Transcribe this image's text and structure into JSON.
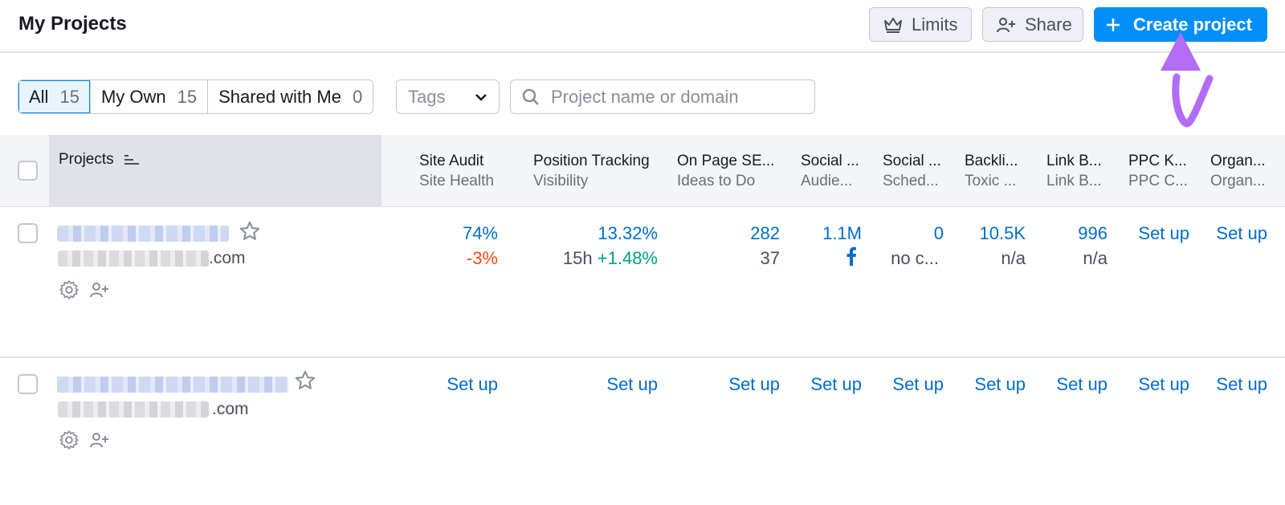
{
  "header": {
    "title": "My Projects",
    "limits_label": "Limits",
    "share_label": "Share",
    "create_label": "Create project"
  },
  "filters": {
    "segments": [
      {
        "label": "All",
        "count": "15"
      },
      {
        "label": "My Own",
        "count": "15"
      },
      {
        "label": "Shared with Me",
        "count": "0"
      }
    ],
    "tags_label": "Tags",
    "search_placeholder": "Project name or domain"
  },
  "table": {
    "projects_header": "Projects",
    "columns": [
      {
        "title": "Site Audit",
        "sub": "Site Health"
      },
      {
        "title": "Position Tracking",
        "sub": "Visibility"
      },
      {
        "title": "On Page SE...",
        "sub": "Ideas to Do"
      },
      {
        "title": "Social ...",
        "sub": "Audie..."
      },
      {
        "title": "Social ...",
        "sub": "Sched..."
      },
      {
        "title": "Backli...",
        "sub": "Toxic ..."
      },
      {
        "title": "Link B...",
        "sub": "Link B..."
      },
      {
        "title": "PPC K...",
        "sub": "PPC C..."
      },
      {
        "title": "Organ...",
        "sub": "Organ..."
      }
    ],
    "rows": [
      {
        "domain_suffix": ".com",
        "site_audit": "74%",
        "site_audit_delta": "-3%",
        "position_tracking": "13.32%",
        "position_time": "15h",
        "position_delta": "+1.48%",
        "on_page": "282",
        "on_page_sub": "37",
        "social_aud": "1.1M",
        "social_sched": "0",
        "social_sched_sub": "no c...",
        "backlinks": "10.5K",
        "backlinks_sub": "n/a",
        "link_building": "996",
        "link_building_sub": "n/a",
        "ppc": "Set up",
        "organic": "Set up"
      },
      {
        "domain_suffix": ".com",
        "setup": [
          "Set up",
          "Set up",
          "Set up",
          "Set up",
          "Set up",
          "Set up",
          "Set up",
          "Set up",
          "Set up"
        ]
      }
    ]
  },
  "colors": {
    "primary": "#008ff8",
    "link": "#006dca",
    "negative": "#f54b13",
    "positive": "#009f81",
    "annotation_arrow": "#b36cf5"
  }
}
